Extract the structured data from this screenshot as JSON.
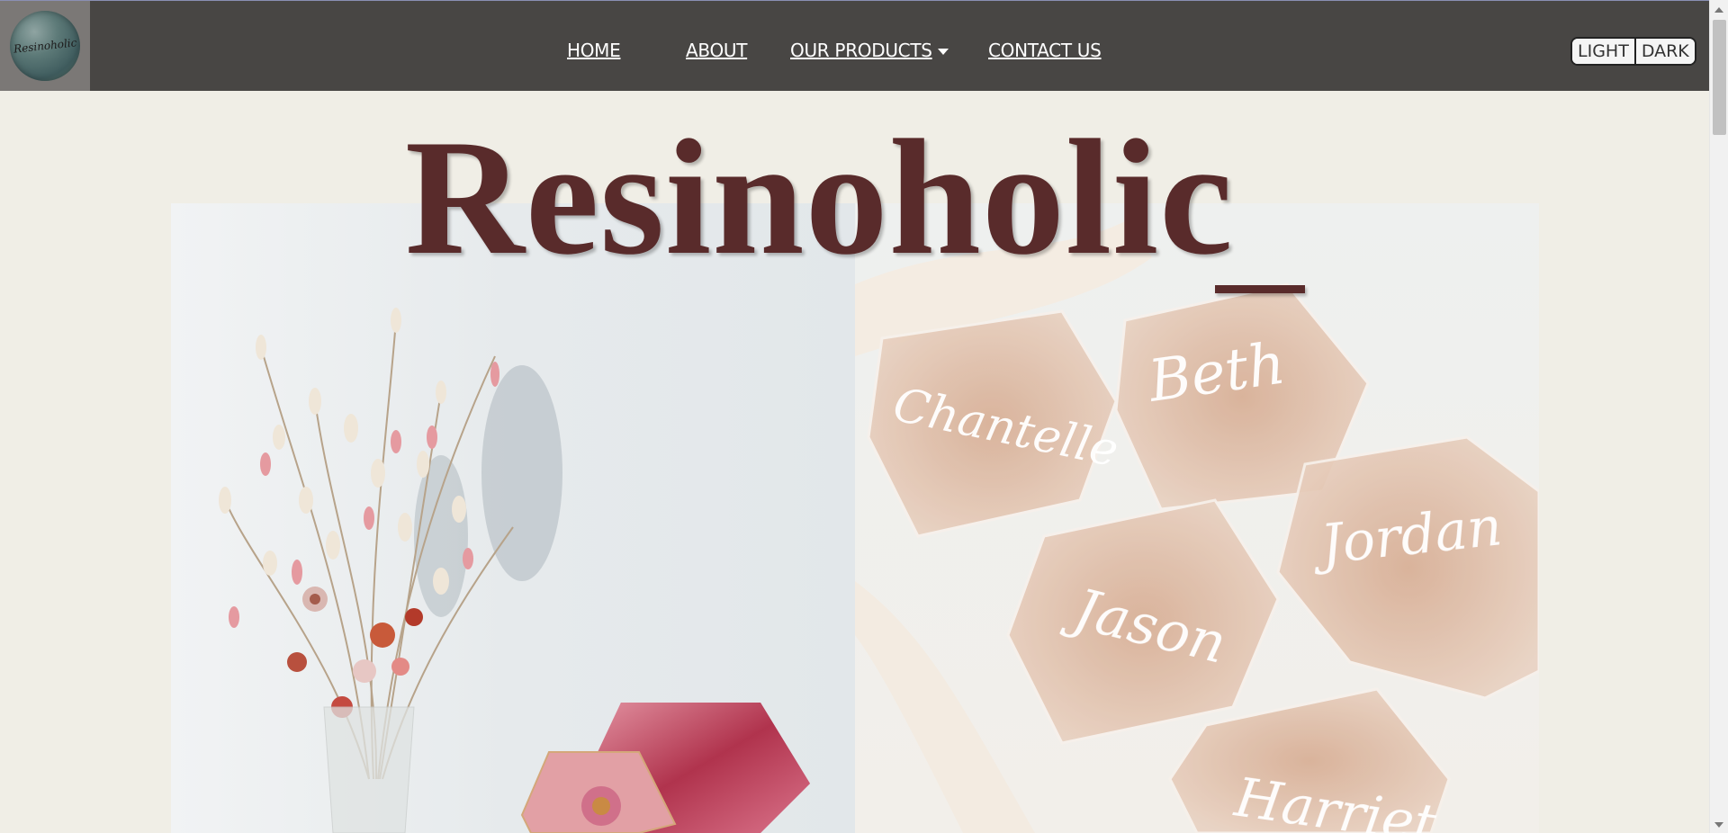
{
  "brand": {
    "logo_text": "Resinoholic",
    "title": "Resinoholic",
    "cursor": "_"
  },
  "nav": {
    "items": [
      {
        "label": "HOME"
      },
      {
        "label": "ABOUT"
      },
      {
        "label": "OUR PRODUCTS"
      },
      {
        "label": "CONTACT US"
      }
    ]
  },
  "theme": {
    "light_label": "LIGHT",
    "dark_label": "DARK"
  },
  "hero": {
    "left_image": "dried-flowers-vase-with-pink-resin-coasters",
    "right_image": "hexagon-name-place-cards",
    "place_card_names": [
      "Chantelle",
      "Beth",
      "Jason",
      "Jordan",
      "Harriet"
    ]
  },
  "colors": {
    "navbar": "#484644",
    "background": "#f0eee6",
    "title": "#592b2b"
  }
}
